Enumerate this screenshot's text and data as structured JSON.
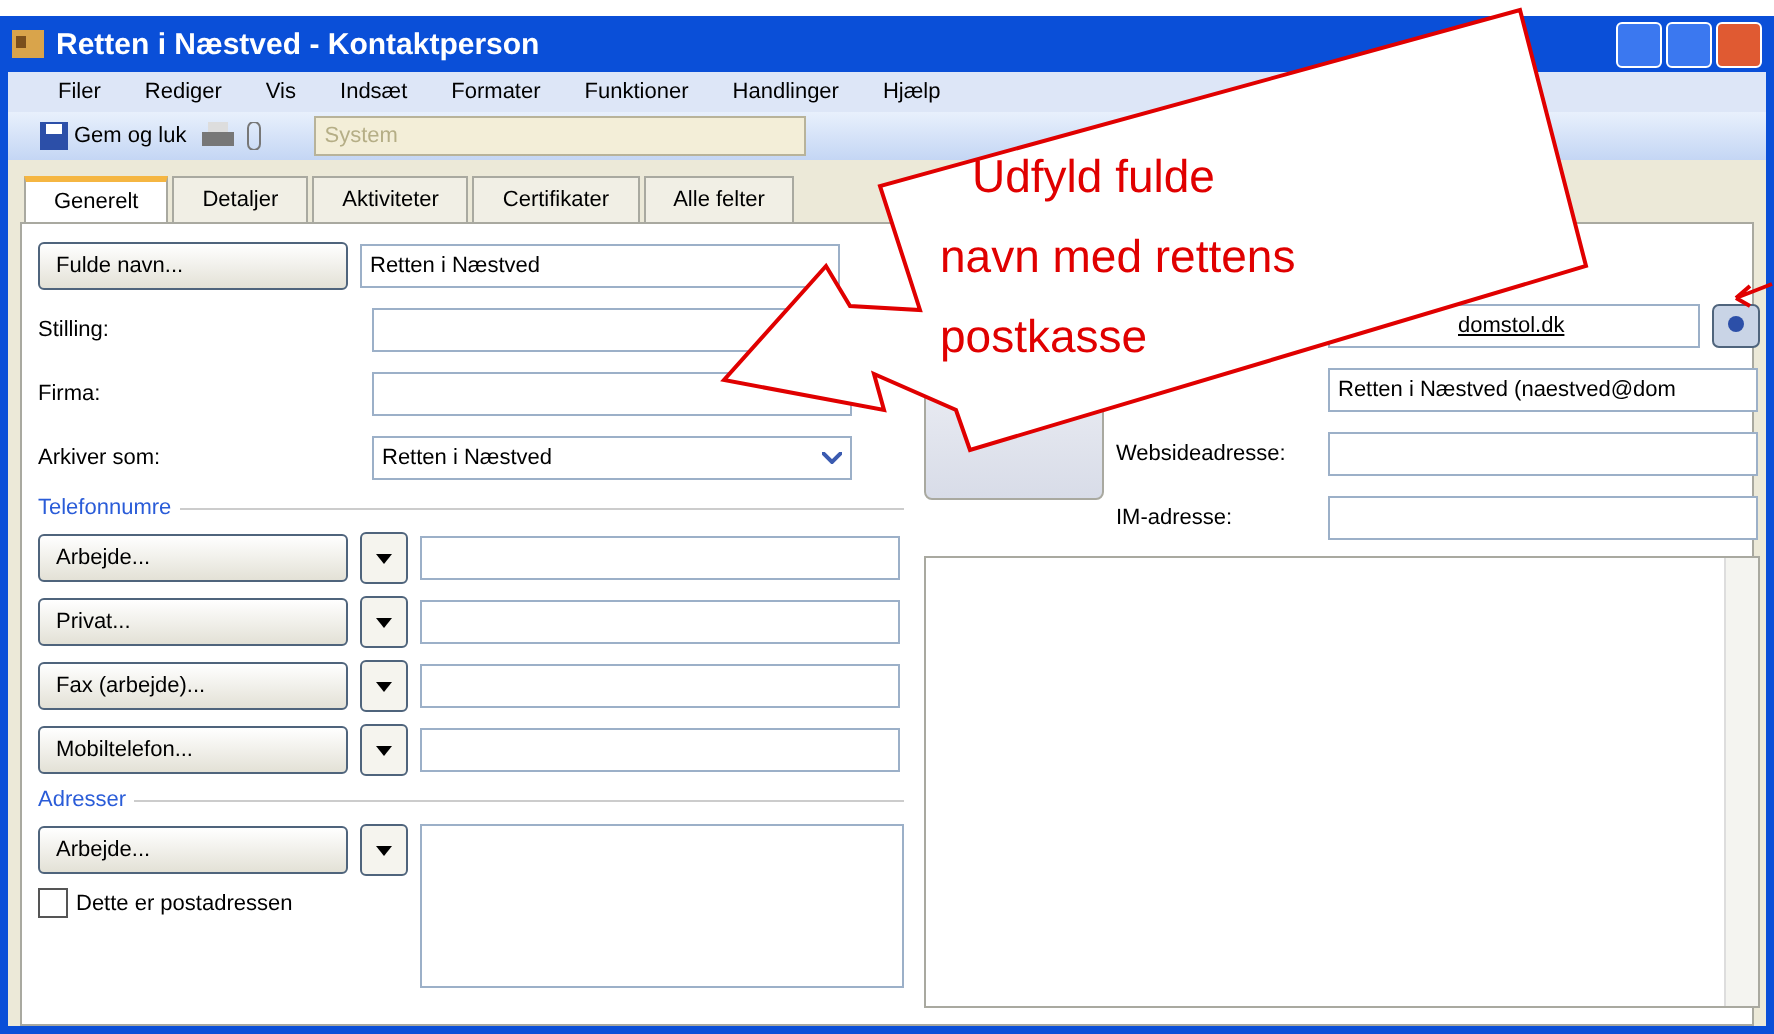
{
  "window": {
    "title": "Retten i Næstved - Kontaktperson"
  },
  "menu": [
    "Filer",
    "Rediger",
    "Vis",
    "Indsæt",
    "Formater",
    "Funktioner",
    "Handlinger",
    "Hjælp"
  ],
  "toolbar": {
    "save_button": "Gem og luk",
    "category_field": "System"
  },
  "tabs": [
    {
      "label": "Generelt",
      "selected": true
    },
    {
      "label": "Detaljer",
      "selected": false
    },
    {
      "label": "Aktiviteter",
      "selected": false
    },
    {
      "label": "Certifikater",
      "selected": false
    },
    {
      "label": "Alle felter",
      "selected": false
    }
  ],
  "name_rows": [
    {
      "kind": "button",
      "label": "Fulde navn...",
      "value": "Retten i Næstved"
    },
    {
      "kind": "label",
      "label": "Stilling:"
    },
    {
      "kind": "label",
      "label": "Firma:"
    },
    {
      "kind": "dropdown",
      "label": "Arkiver som:",
      "value": "Retten i Næstved"
    }
  ],
  "phone_section": {
    "title": "Telefonnumre",
    "rows": [
      {
        "label": "Arbejde..."
      },
      {
        "label": "Privat..."
      },
      {
        "label": "Fax (arbejde)..."
      },
      {
        "label": "Mobiltelefon..."
      }
    ]
  },
  "address_section": {
    "title": "Adresser",
    "button": "Arbejde...",
    "checkbox": {
      "label": "Dette er postadressen",
      "checked": false
    }
  },
  "right_fields": [
    {
      "kind": "email",
      "value": "domstol.dk"
    },
    {
      "kind": "plain",
      "value": "Retten i Næstved (naestved@dom"
    },
    {
      "kind": "plain",
      "label": "Websideadresse:"
    },
    {
      "kind": "plain",
      "label": "IM-adresse:"
    }
  ],
  "callout": {
    "lines": [
      "Udfyld fulde",
      "navn med rettens",
      "postkasse"
    ]
  }
}
